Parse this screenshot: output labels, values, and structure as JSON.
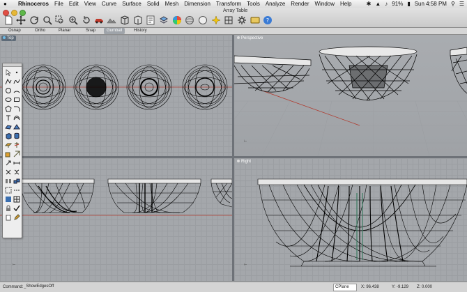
{
  "menubar": {
    "apple": "",
    "items": [
      "Rhinoceros",
      "File",
      "Edit",
      "View",
      "Curve",
      "Surface",
      "Solid",
      "Mesh",
      "Dimension",
      "Transform",
      "Tools",
      "Analyze",
      "Render",
      "Window",
      "Help"
    ],
    "battery": "91%",
    "clock": "Sun 4:58 PM"
  },
  "window": {
    "title": "Array Table"
  },
  "command_tabs": [
    "Osnap",
    "Ortho",
    "Planar",
    "Snap",
    "Gumball",
    "History"
  ],
  "viewports": {
    "top": "Top",
    "perspective": "Perspective",
    "front": "",
    "right": "Right"
  },
  "status": {
    "command_label": "Command:",
    "command_value": "_ShowEdgesOff",
    "cplane": "CPlane",
    "x": "X: 96.438",
    "y": "Y: -9.129",
    "z": "Z: 0.000"
  },
  "colors": {
    "viewport_bg": "#a4a7ab",
    "active_label": "#5e6b78",
    "wire": "#000000",
    "axis_red": "#c0392b"
  },
  "icons": [
    "new-icon",
    "open-icon",
    "save-icon",
    "print-icon",
    "select-icon",
    "pan-icon",
    "rotate-icon",
    "zoom-icon",
    "zoom-window-icon",
    "zoom-extents-icon",
    "undo-icon",
    "car-icon",
    "render-icon",
    "properties-icon",
    "color-wheel-icon",
    "sphere-icon",
    "material-icon",
    "layer-icon",
    "light-icon",
    "settings-icon",
    "help-icon"
  ]
}
